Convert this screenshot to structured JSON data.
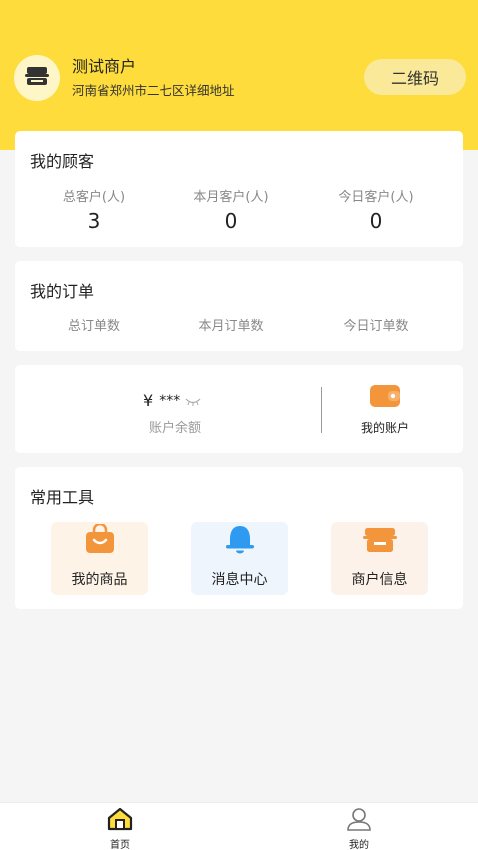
{
  "merchant": {
    "name": "测试商户",
    "address": "河南省郑州市二七区详细地址",
    "qr_label": "二维码",
    "avatar_icon": "shop-icon"
  },
  "customers": {
    "title": "我的顾客",
    "stats": [
      {
        "label": "总客户(人)",
        "value": "3"
      },
      {
        "label": "本月客户(人)",
        "value": "0"
      },
      {
        "label": "今日客户(人)",
        "value": "0"
      }
    ]
  },
  "orders": {
    "title": "我的订单",
    "stats": [
      {
        "label": "总订单数"
      },
      {
        "label": "本月订单数"
      },
      {
        "label": "今日订单数"
      }
    ]
  },
  "balance": {
    "currency": "¥",
    "masked_amount": "***",
    "label": "账户余额",
    "visibility_icon": "eye-closed-icon",
    "account_label": "我的账户",
    "account_icon": "wallet-icon"
  },
  "tools": {
    "title": "常用工具",
    "items": [
      {
        "label": "我的商品",
        "icon": "shopping-bag-icon",
        "bg": "#fdf4e7"
      },
      {
        "label": "消息中心",
        "icon": "bell-icon",
        "bg": "#eef5fd"
      },
      {
        "label": "商户信息",
        "icon": "store-icon",
        "bg": "#fdf2ea"
      }
    ]
  },
  "tabbar": {
    "items": [
      {
        "label": "首页",
        "icon": "home-icon",
        "active": true
      },
      {
        "label": "我的",
        "icon": "user-icon",
        "active": false
      }
    ]
  },
  "colors": {
    "brand_yellow": "#fddc3b",
    "orange": "#f3953b",
    "blue": "#2f9bf0",
    "background": "#f5f5f5"
  }
}
